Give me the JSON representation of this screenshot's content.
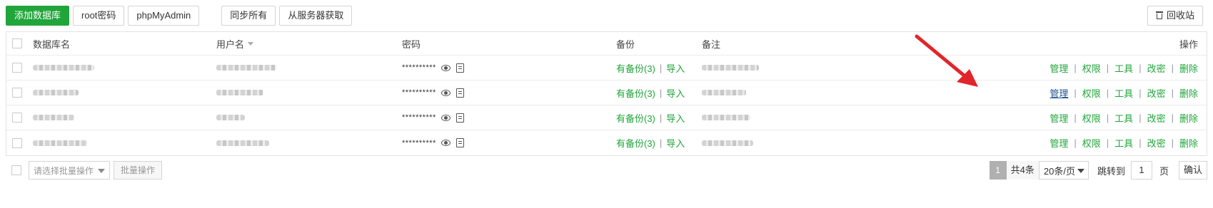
{
  "toolbar": {
    "add_db": "添加数据库",
    "root_pw": "root密码",
    "phpmyadmin": "phpMyAdmin",
    "sync_all": "同步所有",
    "fetch_from_server": "从服务器获取",
    "recycle": "回收站"
  },
  "table": {
    "headers": {
      "name": "数据库名",
      "user": "用户名",
      "password": "密码",
      "backup": "备份",
      "note": "备注",
      "ops": "操作"
    },
    "rows": [
      {
        "password": "**********",
        "backup_link": "有备份(3)",
        "import_link": "导入"
      },
      {
        "password": "**********",
        "backup_link": "有备份(3)",
        "import_link": "导入"
      },
      {
        "password": "**********",
        "backup_link": "有备份(3)",
        "import_link": "导入"
      },
      {
        "password": "**********",
        "backup_link": "有备份(3)",
        "import_link": "导入"
      }
    ],
    "ops": {
      "manage": "管理",
      "perms": "权限",
      "tools": "工具",
      "change_pw": "改密",
      "delete": "删除",
      "separator": "|"
    }
  },
  "footer": {
    "batch_placeholder": "请选择批量操作",
    "batch_button": "批量操作",
    "current_page": "1",
    "total": "共4条",
    "page_size": "20条/页",
    "jump_label": "跳转到",
    "jump_value": "1",
    "page_unit": "页",
    "confirm": "确认"
  },
  "colors": {
    "accent": "#20a53a",
    "link_active": "#1d4e8f",
    "annotation_arrow": "#e0262b"
  }
}
